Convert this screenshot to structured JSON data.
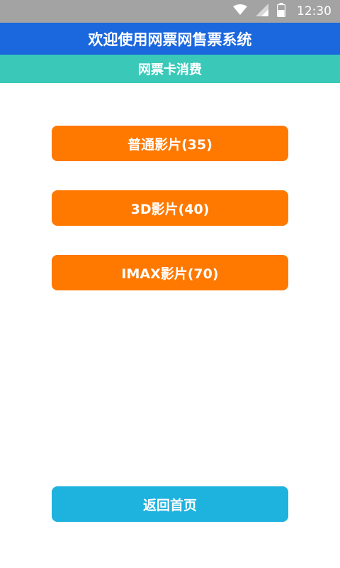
{
  "status_bar": {
    "time": "12:30",
    "icons": [
      "wifi-icon",
      "signal-icon",
      "battery-icon"
    ]
  },
  "header": {
    "title": "欢迎使用网票网售票系统"
  },
  "sub_header": {
    "title": "网票卡消费"
  },
  "options": [
    {
      "label": "普通影片(35)"
    },
    {
      "label": "3D影片(40)"
    },
    {
      "label": "IMAX影片(70)"
    }
  ],
  "footer": {
    "home_label": "返回首页"
  },
  "colors": {
    "status_bar": "#a3a3a3",
    "header": "#1a67de",
    "sub_header": "#3ac9b9",
    "option_button": "#ff7900",
    "home_button": "#1eb2de"
  }
}
